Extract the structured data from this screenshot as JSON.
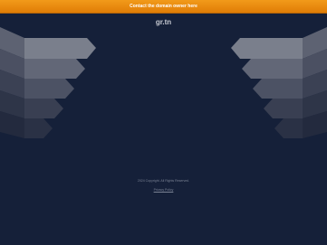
{
  "topbar": {
    "label": "Contact the domain owner here"
  },
  "domain": {
    "name": "gr.tn"
  },
  "footer": {
    "copyright": "2024 Copyright. All Rights Reserved.",
    "privacy": "Privacy Policy"
  },
  "colors": {
    "background": "#152039",
    "topbar": "#ee8a0d",
    "arrow_light": "#7a7f8c"
  }
}
